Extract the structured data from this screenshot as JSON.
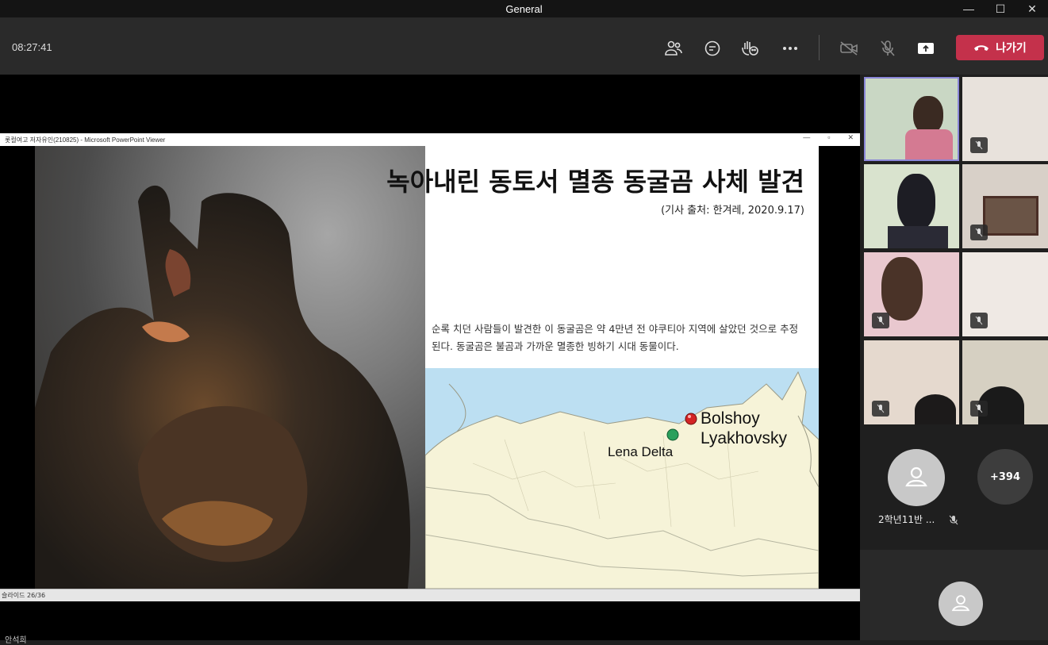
{
  "window": {
    "title": "General",
    "controls": [
      "—",
      "☐",
      "✕"
    ]
  },
  "meeting": {
    "clock": "08:27:41",
    "leave_label": "나가기",
    "colors": {
      "leave": "#c4314b",
      "toolbar": "#2a2a2a"
    }
  },
  "ppt": {
    "window_title": "롯컬여고 저자유인(210825) - Microsoft PowerPoint Viewer",
    "window_controls": [
      "—",
      "▫",
      "✕"
    ],
    "status": "슬라이드 26/36",
    "slide": {
      "title": "녹아내린 동토서 멸종 동굴곰 사체 발견",
      "source": "(기사 출처: 한겨레, 2020.9.17)",
      "body": "순록 치던 사람들이 발견한 이 동굴곰은 약 4만년 전 야쿠티아 지역에 살았던 것으로 추정된다. 동굴곰은 불곰과 가까운 멸종한 빙하기 시대 동물이다.",
      "map": {
        "label_1": "Bolshoy",
        "label_2": "Lyakhovsky",
        "label_3": "Lena Delta"
      }
    }
  },
  "bottom_caption": "안석희",
  "participants": {
    "overflow_count": "+394",
    "named": "2학년11반 ..."
  }
}
